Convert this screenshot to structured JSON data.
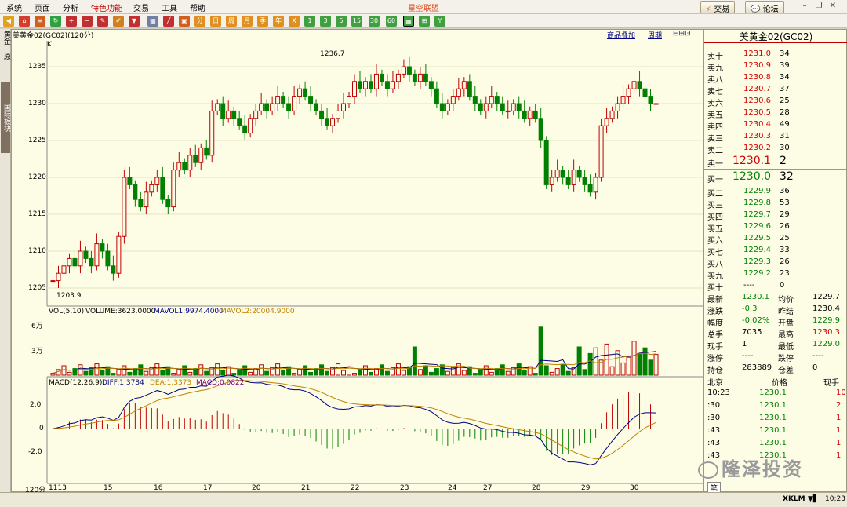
{
  "menu": {
    "items": [
      "系统",
      "页面",
      "分析",
      "特色功能",
      "交易",
      "工具",
      "帮助"
    ],
    "title": "星空联盟",
    "trade_btn": "交易",
    "forum_btn": "论坛"
  },
  "toolbar": {
    "period_buttons": [
      "1",
      "3",
      "5",
      "15",
      "30",
      "60"
    ]
  },
  "lefttabs": [
    "黄金",
    "原",
    "国际板块"
  ],
  "chart": {
    "header": "美黄金02(GC02)(120分)",
    "k_label": "K",
    "link_overlay": "商品叠加",
    "link_period": "周期",
    "price_ticks": [
      "1235",
      "1230",
      "1225",
      "1220",
      "1215",
      "1210",
      "1205"
    ],
    "high_label": "1236.7",
    "low_label": "1203.9",
    "vol_header": {
      "vol": "VOL(5,10)",
      "volume": "VOLUME:3623.0000",
      "mavol1": "MAVOL1:9974.4000",
      "mavol2": "MAVOL2:20004.9000"
    },
    "vol_ticks": [
      "6万",
      "3万"
    ],
    "macd_header": {
      "macd": "MACD(12,26,9)",
      "diff": "DIFF:1.3784",
      "dea": "DEA:1.3373",
      "macdv": "MACD:0.0822"
    },
    "macd_ticks": [
      "2.0",
      "0",
      "-2.0"
    ],
    "period_label": "120分",
    "date_labels": [
      "1113",
      "15",
      "16",
      "17",
      "20",
      "21",
      "22",
      "23",
      "24",
      "27",
      "28",
      "29",
      "30"
    ],
    "colors": {
      "up": "#c00000",
      "down": "#008000",
      "ma1": "#000080",
      "ma2": "#c08000"
    }
  },
  "panel": {
    "title": "美黄金02(GC02)",
    "sells": [
      {
        "label": "卖十",
        "price": "1231.0",
        "vol": "34"
      },
      {
        "label": "卖九",
        "price": "1230.9",
        "vol": "39"
      },
      {
        "label": "卖八",
        "price": "1230.8",
        "vol": "34"
      },
      {
        "label": "卖七",
        "price": "1230.7",
        "vol": "37"
      },
      {
        "label": "卖六",
        "price": "1230.6",
        "vol": "25"
      },
      {
        "label": "卖五",
        "price": "1230.5",
        "vol": "28"
      },
      {
        "label": "卖四",
        "price": "1230.4",
        "vol": "49"
      },
      {
        "label": "卖三",
        "price": "1230.3",
        "vol": "31"
      },
      {
        "label": "卖二",
        "price": "1230.2",
        "vol": "30"
      }
    ],
    "sell1": {
      "label": "卖一",
      "price": "1230.1",
      "vol": "2"
    },
    "buy1": {
      "label": "买一",
      "price": "1230.0",
      "vol": "32"
    },
    "buys": [
      {
        "label": "买二",
        "price": "1229.9",
        "vol": "36"
      },
      {
        "label": "买三",
        "price": "1229.8",
        "vol": "53"
      },
      {
        "label": "买四",
        "price": "1229.7",
        "vol": "29"
      },
      {
        "label": "买五",
        "price": "1229.6",
        "vol": "26"
      },
      {
        "label": "买六",
        "price": "1229.5",
        "vol": "25"
      },
      {
        "label": "买七",
        "price": "1229.4",
        "vol": "33"
      },
      {
        "label": "买八",
        "price": "1229.3",
        "vol": "26"
      },
      {
        "label": "买九",
        "price": "1229.2",
        "vol": "23"
      },
      {
        "label": "买十",
        "price": "----",
        "vol": "0"
      }
    ],
    "stats": [
      {
        "l1": "最新",
        "v1": "1230.1",
        "l2": "均价",
        "v2": "1229.7"
      },
      {
        "l1": "涨跌",
        "v1": "-0.3",
        "l2": "昨结",
        "v2": "1230.4"
      },
      {
        "l1": "幅度",
        "v1": "-0.02%",
        "l2": "开盘",
        "v2": "1229.9"
      },
      {
        "l1": "总手",
        "v1": "7035",
        "l2": "最高",
        "v2": "1230.3"
      },
      {
        "l1": "现手",
        "v1": "1",
        "l2": "最低",
        "v2": "1229.0"
      },
      {
        "l1": "涨停",
        "v1": "----",
        "l2": "跌停",
        "v2": "----"
      },
      {
        "l1": "持仓",
        "v1": "283889",
        "l2": "仓差",
        "v2": "0"
      }
    ],
    "ticks_header": {
      "c1": "北京",
      "c2": "价格",
      "c3": "现手"
    },
    "ticks": [
      {
        "t": "10:23",
        "p": "1230.1",
        "v": "10"
      },
      {
        "t": ":30",
        "p": "1230.1",
        "v": "2"
      },
      {
        "t": ":30",
        "p": "1230.1",
        "v": "1"
      },
      {
        "t": ":43",
        "p": "1230.1",
        "v": "1"
      },
      {
        "t": ":43",
        "p": "1230.1",
        "v": "1"
      },
      {
        "t": ":43",
        "p": "1230.1",
        "v": "1"
      }
    ],
    "tab": "笔"
  },
  "status": {
    "logo": "XKLM",
    "time": "10:23"
  },
  "watermark": "隆泽投资"
}
